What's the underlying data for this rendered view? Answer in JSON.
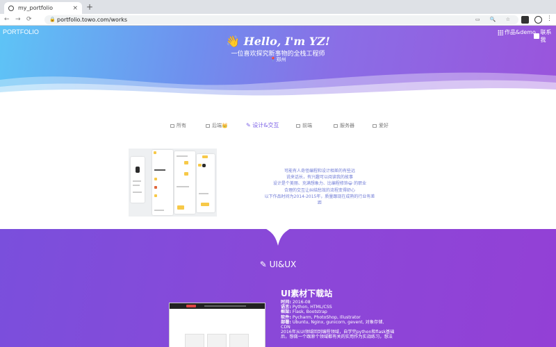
{
  "browser": {
    "tab_title": "my_portfolio",
    "tab_close": "×",
    "new_tab": "+",
    "url": "portfolio.towo.com/works",
    "back": "←",
    "forward": "→",
    "reload": "⟳",
    "lock_icon": "🔒",
    "omni_icons": "▭ 🔍 ☆",
    "menu": "⋮"
  },
  "hero": {
    "brand": "PORTFOLIO",
    "nav_works": "作品&demo",
    "nav_contact": "联系我",
    "wave_emoji": "👋",
    "greeting": "Hello, I'm YZ!",
    "subtitle": "一位喜欢探究新事物的全栈工程师",
    "location_icon": "📍",
    "location": "郑州"
  },
  "filters": [
    {
      "label": "所有",
      "active": false
    },
    {
      "label": "后端👑",
      "active": false
    },
    {
      "label": "设计&交互",
      "active": true
    },
    {
      "label": "前端",
      "active": false
    },
    {
      "label": "服务器",
      "active": false
    },
    {
      "label": "爱好",
      "active": false
    }
  ],
  "design_icon": "✎",
  "description": [
    "可能有人奇怪编程和设计相差的有些远",
    "说来话长，有兴趣可以阅读我的故事",
    "设计是个美丽、充满想象力、比编程修饰😀 的职业",
    "合理的交互让纠结愁效的流程变得舒心",
    "以下作品时间为2014-2015年，质量跟现在成熟的行业有差距"
  ],
  "section": {
    "icon": "✎",
    "title": "UI&UX"
  },
  "project": {
    "title": "UI素材下载站",
    "fields": [
      {
        "key": "时间:",
        "value": "2016-08"
      },
      {
        "key": "语言:",
        "value": "Python, HTML/CSS"
      },
      {
        "key": "框架:",
        "value": "Flask, Bootstrap"
      },
      {
        "key": "软件:",
        "value": "Pycharm, PhotoShop, Illustrator"
      },
      {
        "key": "部署:",
        "value": "Ubuntu, Nginx, gunicorn, gevent, 对象存储,"
      }
    ],
    "cdn_line": "CDN",
    "body_line1": "2016年从UI领域回到编程领域，自学完python和flask基础",
    "body_line2": "后，想做一个跟原个领域都有关的实用作为实战练习，想法"
  },
  "colors": {
    "accent": "#7a5fe6",
    "hero_start": "#5ec4f6",
    "hero_end": "#9a54dc",
    "bottom": "#8a48d8"
  }
}
